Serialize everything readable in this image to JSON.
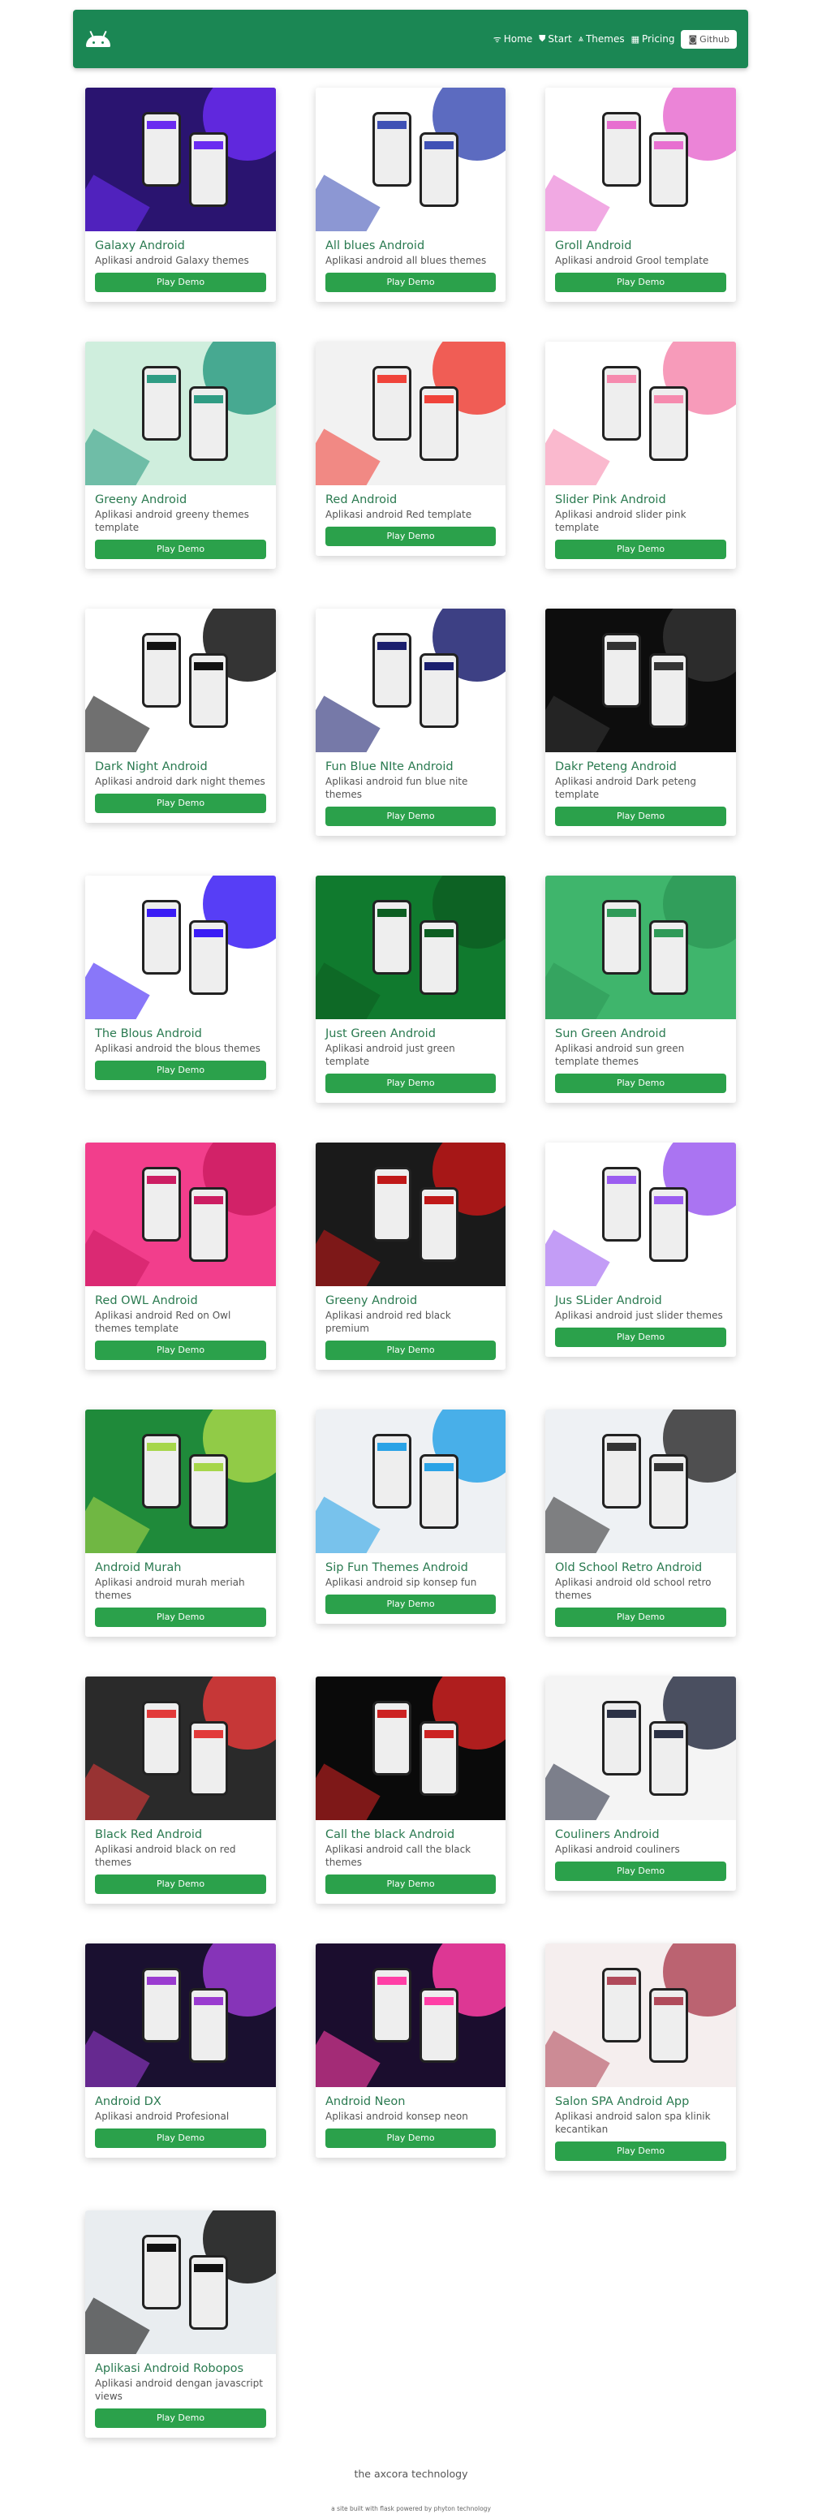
{
  "nav": {
    "logo": "android-icon",
    "links": [
      {
        "label": "Home",
        "icon": "wifi-icon",
        "glyph": "ᯤ"
      },
      {
        "label": "Start",
        "icon": "shield-icon",
        "glyph": "⛊"
      },
      {
        "label": "Themes",
        "icon": "compass-icon",
        "glyph": "⩓"
      },
      {
        "label": "Pricing",
        "icon": "printer-icon",
        "glyph": "▦"
      }
    ],
    "github": {
      "label": "Github",
      "icon": "github-icon",
      "glyph": "◙"
    }
  },
  "colors": {
    "header": "#1b8754",
    "title": "#2a7a50",
    "button": "#2ba14b"
  },
  "button_label": "Play Demo",
  "cards": [
    {
      "title": "Galaxy Android",
      "desc": "Aplikasi android Galaxy themes",
      "bg": "#2a1470",
      "accent": "#6a2cf0"
    },
    {
      "title": "All blues Android",
      "desc": "Aplikasi android all blues themes",
      "bg": "#ffffff",
      "accent": "#3f51b5"
    },
    {
      "title": "Groll Android",
      "desc": "Aplikasi android Grool template",
      "bg": "#ffffff",
      "accent": "#e76fd0"
    },
    {
      "title": "Greeny Android",
      "desc": "Aplikasi android greeny themes template",
      "bg": "#cfeedd",
      "accent": "#2f9c84"
    },
    {
      "title": "Red Android",
      "desc": "Aplikasi android Red template",
      "bg": "#f2f2f2",
      "accent": "#f0433a"
    },
    {
      "title": "Slider Pink Android",
      "desc": "Aplikasi android slider pink template",
      "bg": "#ffffff",
      "accent": "#f68aae"
    },
    {
      "title": "Dark Night Android",
      "desc": "Aplikasi android dark night themes",
      "bg": "#ffffff",
      "accent": "#111111"
    },
    {
      "title": "Fun Blue NIte Android",
      "desc": "Aplikasi android fun blue nite themes",
      "bg": "#ffffff",
      "accent": "#1b1f6e"
    },
    {
      "title": "Dakr Peteng Android",
      "desc": "Aplikasi android Dark peteng template",
      "bg": "#0d0d0d",
      "accent": "#333333"
    },
    {
      "title": "The Blous Android",
      "desc": "Aplikasi android the blous themes",
      "bg": "#ffffff",
      "accent": "#3a1cf5"
    },
    {
      "title": "Just Green Android",
      "desc": "Aplikasi android just green template",
      "bg": "#107a2e",
      "accent": "#0d5e22"
    },
    {
      "title": "Sun Green Android",
      "desc": "Aplikasi android sun green template themes",
      "bg": "#3fb56c",
      "accent": "#2f9a58"
    },
    {
      "title": "Red OWL Android",
      "desc": "Aplikasi android Red on Owl themes template",
      "bg": "#f23e8c",
      "accent": "#cc1d62"
    },
    {
      "title": "Greeny Android",
      "desc": "Aplikasi android red black premium",
      "bg": "#1a1a1a",
      "accent": "#c01818"
    },
    {
      "title": "Jus SLider Android",
      "desc": "Aplikasi android just slider themes",
      "bg": "#ffffff",
      "accent": "#9b5cf0"
    },
    {
      "title": "Android Murah",
      "desc": "Aplikasi android murah meriah themes",
      "bg": "#1f8a3a",
      "accent": "#a6d64a"
    },
    {
      "title": "Sip Fun Themes Android",
      "desc": "Aplikasi android sip konsep fun",
      "bg": "#eef1f4",
      "accent": "#2aa3e6"
    },
    {
      "title": "Old School Retro Android",
      "desc": "Aplikasi android old school retro themes",
      "bg": "#eef1f4",
      "accent": "#333333"
    },
    {
      "title": "Black Red Android",
      "desc": "Aplikasi android black on red themes",
      "bg": "#2a2a2a",
      "accent": "#e23a3a"
    },
    {
      "title": "Call the black Android",
      "desc": "Aplikasi android call the black themes",
      "bg": "#0a0a0a",
      "accent": "#cc2222"
    },
    {
      "title": "Couliners Android",
      "desc": "Aplikasi android couliners",
      "bg": "#f4f4f4",
      "accent": "#2b3145"
    },
    {
      "title": "Android DX",
      "desc": "Aplikasi android Profesional",
      "bg": "#1a1030",
      "accent": "#9a3bd0"
    },
    {
      "title": "Android Neon",
      "desc": "Aplikasi android konsep neon",
      "bg": "#1b0d2e",
      "accent": "#ff3fa6"
    },
    {
      "title": "Salon SPA Android App",
      "desc": "Aplikasi android salon spa klinik kecantikan",
      "bg": "#f5eeee",
      "accent": "#b04a5a"
    },
    {
      "title": "Aplikasi Android Robopos",
      "desc": "Aplikasi android dengan javascript views",
      "bg": "#e9edf0",
      "accent": "#111111"
    }
  ],
  "footer": {
    "brand": "the axcora technology",
    "note": "a site built with flask powered by phyton technology"
  }
}
